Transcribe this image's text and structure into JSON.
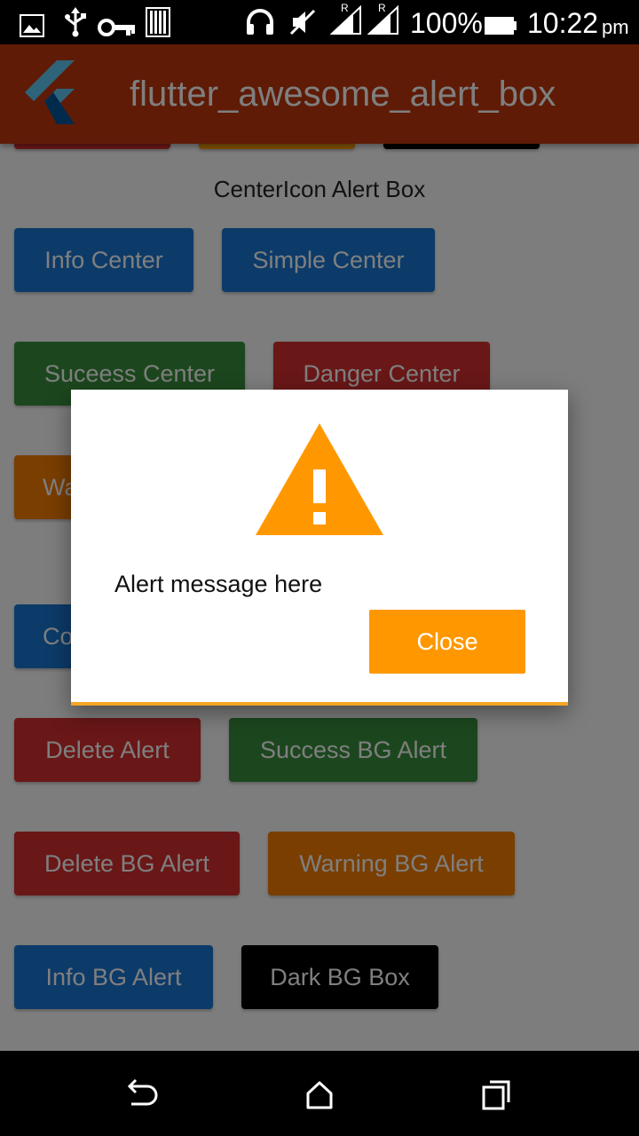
{
  "status_bar": {
    "battery": "100%",
    "time": "10:22",
    "ampm": "pm",
    "signal_label_1": "R",
    "signal_label_2": "R"
  },
  "app_bar": {
    "title": "flutter_awesome_alert_box"
  },
  "content": {
    "section_title": "CenterIcon Alert Box",
    "buttons": {
      "info_center": "Info Center",
      "simple_center": "Simple Center",
      "success_center": "Suceess Center",
      "danger_center": "Danger Center",
      "warning_center_partial": "Wa",
      "confirm_center_partial": "Co",
      "delete_alert": "Delete Alert",
      "success_bg_alert": "Success BG Alert",
      "delete_bg_alert": "Delete BG Alert",
      "warning_bg_alert": "Warning BG Alert",
      "info_bg_alert": "Info BG Alert",
      "dark_bg_box": "Dark BG Box"
    }
  },
  "dialog": {
    "message": "Alert message here",
    "close_label": "Close",
    "icon": "warning-triangle-icon"
  },
  "colors": {
    "app_bar": "#bf360c",
    "warning": "#ff9800",
    "blue": "#1976d2",
    "green": "#388e3c",
    "red": "#d32f2f",
    "orange": "#f57c00"
  }
}
